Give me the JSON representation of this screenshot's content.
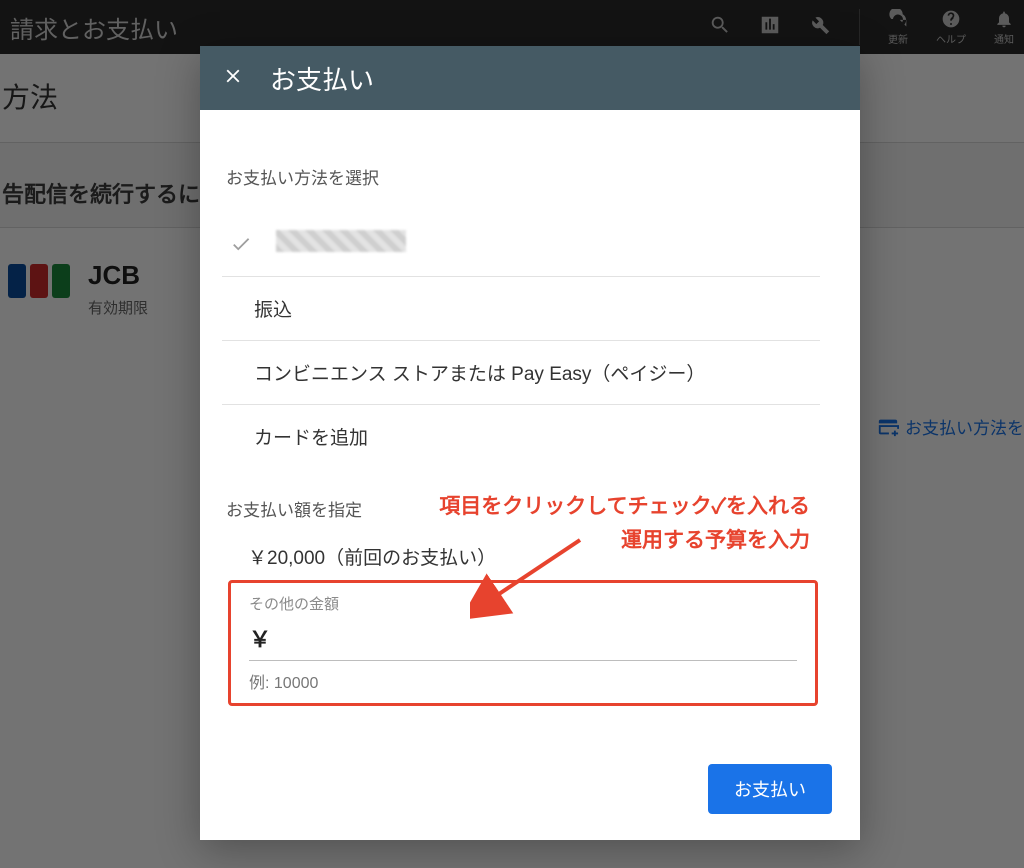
{
  "topbar": {
    "title": "請求とお支払い",
    "actions": {
      "refresh": "更新",
      "help": "ヘルプ",
      "notifications": "通知"
    }
  },
  "page": {
    "header": "方法",
    "banner": "告配信を続行するに",
    "card_brand": "JCB",
    "card_sub": "有効期限",
    "add_method_link": "お支払い方法を"
  },
  "modal": {
    "title": "お支払い",
    "select_method_label": "お支払い方法を選択",
    "methods": [
      {
        "label": "",
        "checked": true,
        "redacted": true
      },
      {
        "label": "振込",
        "checked": false
      },
      {
        "label": "コンビニエンス ストアまたは Pay Easy（ペイジー）",
        "checked": false
      },
      {
        "label": "カードを追加",
        "checked": false
      }
    ],
    "amount_label": "お支払い額を指定",
    "previous_amount": "￥20,000（前回のお支払い）",
    "other_amount_label": "その他の金額",
    "currency_symbol": "￥",
    "amount_value": "",
    "amount_example": "例: 10000",
    "submit": "お支払い"
  },
  "annotation": {
    "line1": "項目をクリックしてチェック✓を入れる",
    "line2": "運用する予算を入力"
  }
}
